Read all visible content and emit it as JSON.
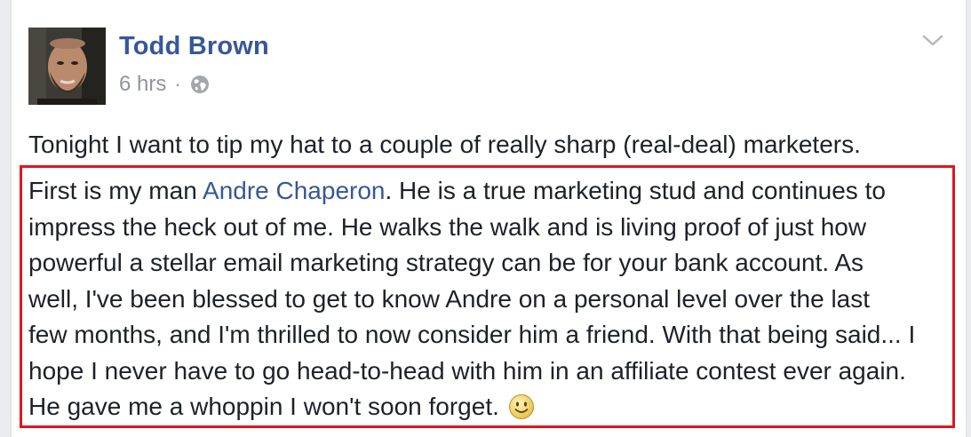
{
  "post": {
    "author": "Todd Brown",
    "timestamp": "6 hrs",
    "separator": "·",
    "privacy_icon": "globe-icon",
    "menu_icon": "chevron-down-icon",
    "intro_text": "Tonight I want to tip my hat to a couple of really sharp (real-deal) marketers.",
    "body": {
      "line1_pre": "First is my man ",
      "line1_link": "Andre Chaperon",
      "line1_post": ". He is a true marketing stud and continues to",
      "line2": "impress the heck out of me. He walks the walk and is living proof of just how",
      "line3": "powerful a stellar email marketing strategy can be for your bank account. As",
      "line4": "well, I've been blessed to get to know Andre on a personal level over the last",
      "line5": "few months, and I'm thrilled to now consider him a friend. With that being said... I",
      "line6": "hope I never have to go head-to-head with him in an affiliate contest ever again.",
      "line7": "He gave me a whoppin I won't soon forget.",
      "emoji": "smiley-icon"
    }
  },
  "colors": {
    "author_blue": "#365899",
    "highlight_red": "#e0161b",
    "meta_gray": "#90949c",
    "text": "#1d2129"
  }
}
